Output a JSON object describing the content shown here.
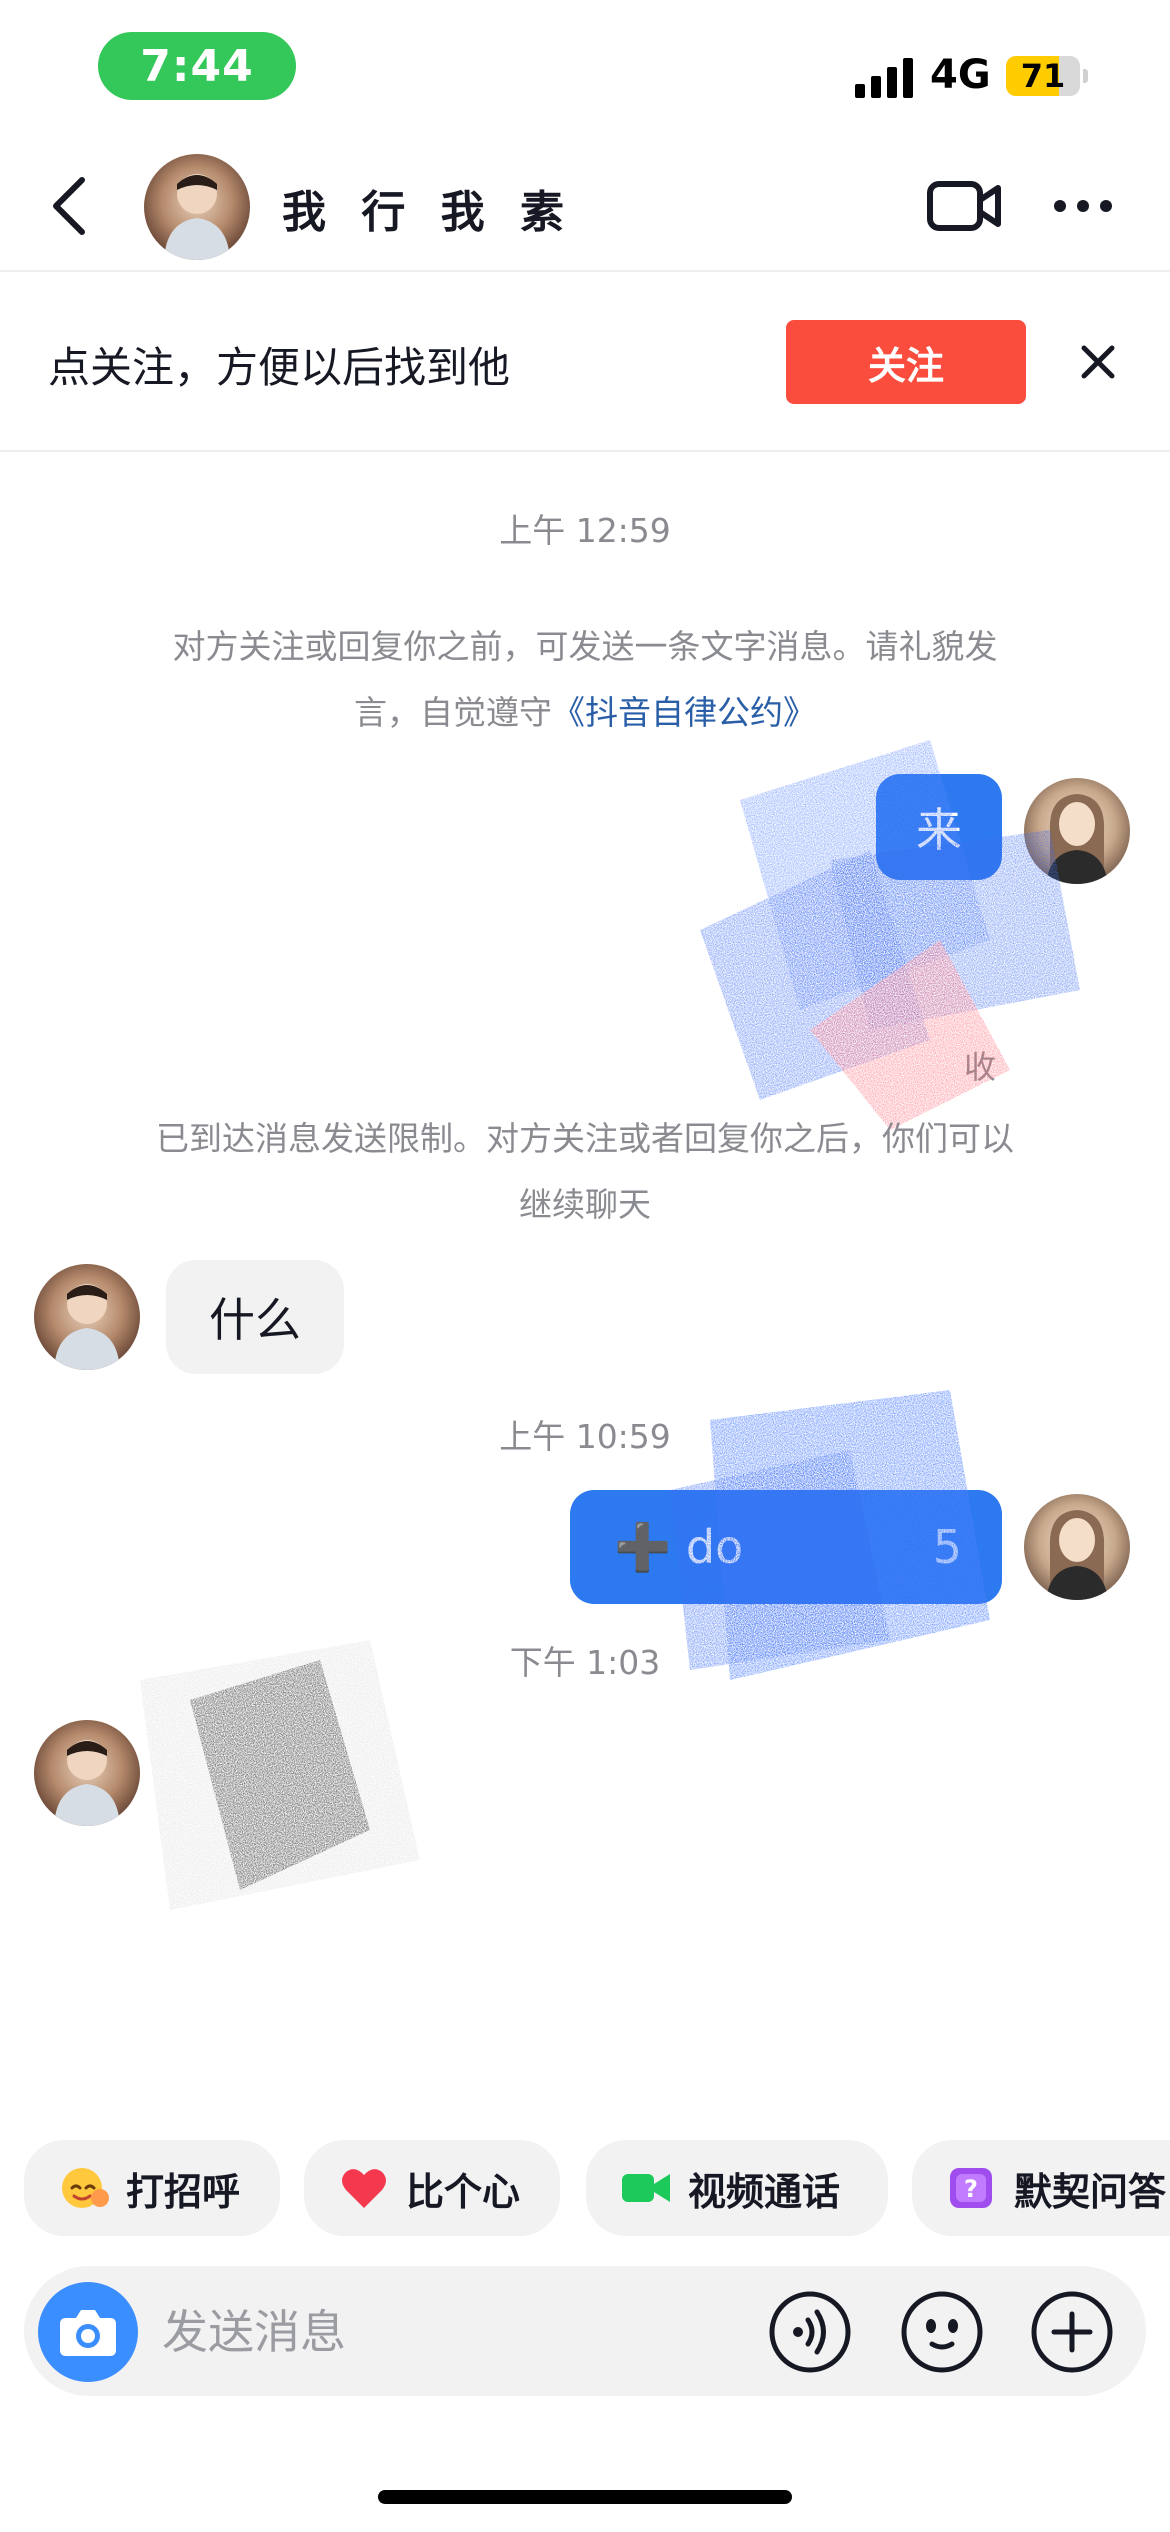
{
  "status_bar": {
    "time": "7:44",
    "network": "4G",
    "battery": "71",
    "battery_level": 0.71,
    "time_pill_color": "#34c759"
  },
  "header": {
    "title": "我 行 我 素",
    "back_icon": "chevron-left-icon",
    "video_icon": "video-call-icon",
    "more_icon": "more-dots-icon"
  },
  "follow_bar": {
    "text": "点关注，方便以后找到他",
    "button_label": "关注",
    "button_color": "#fb4d3d",
    "close_icon": "close-icon"
  },
  "chat": {
    "timestamp_1": "上午 12:59",
    "notice_1_text": "对方关注或回复你之前，可发送一条文字消息。请礼貌发言，自觉遵守",
    "notice_1_link": "《抖音自律公约》",
    "msg_out_1": "来",
    "partial_label": "收",
    "notice_2": "已到达消息发送限制。对方关注或者回复你之后，你们可以继续聊天",
    "msg_in_1": "什么",
    "timestamp_2": "上午 10:59",
    "msg_out_2_prefix": "➕ do",
    "msg_out_2_suffix": "5",
    "timestamp_3": "下午 1:03",
    "outgoing_bubble_color": "#2d79f0",
    "link_color": "#2a5fa8"
  },
  "quick_actions": [
    {
      "label": "打招呼",
      "icon": "wave-emoji-icon"
    },
    {
      "label": "比个心",
      "icon": "heart-icon"
    },
    {
      "label": "视频通话",
      "icon": "video-camera-icon"
    },
    {
      "label": "默契问答",
      "icon": "question-box-icon"
    }
  ],
  "input_bar": {
    "placeholder": "发送消息",
    "camera_icon": "camera-icon",
    "voice_icon": "voice-icon",
    "emoji_icon": "emoji-icon",
    "plus_icon": "plus-icon"
  }
}
